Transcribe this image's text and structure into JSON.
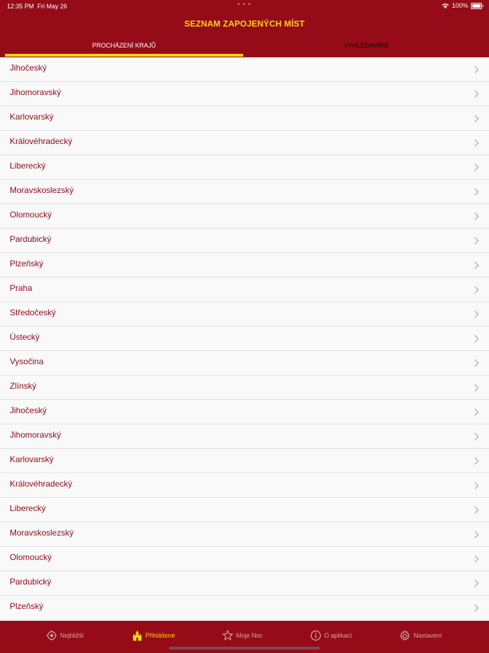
{
  "status_bar": {
    "time": "12:35 PM",
    "date": "Fri May 26",
    "dots": "• • •",
    "battery": "100%"
  },
  "nav": {
    "title": "SEZNAM ZAPOJENÝCH MÍST"
  },
  "tabs": [
    {
      "label": "PROCHÁZENÍ KRAJŮ",
      "active": true
    },
    {
      "label": "VYHLEDÁVÁNÍ",
      "active": false
    }
  ],
  "regions": [
    "Jihočeský",
    "Jihomoravský",
    "Karlovarský",
    "Královéhradecký",
    "Liberecký",
    "Moravskoslezský",
    "Olomoucký",
    "Pardubický",
    "Plzeňský",
    "Praha",
    "Středočeský",
    "Ústecký",
    "Vysočina",
    "Zlínský",
    "Jihočeský",
    "Jihomoravský",
    "Karlovarský",
    "Královéhradecký",
    "Liberecký",
    "Moravskoslezský",
    "Olomoucký",
    "Pardubický",
    "Plzeňský"
  ],
  "tabbar": [
    {
      "label": "Nejbližší",
      "icon": "location-target-icon",
      "active": false
    },
    {
      "label": "Přihlášené",
      "icon": "castle-icon",
      "active": true
    },
    {
      "label": "Moje Noc",
      "icon": "star-icon",
      "active": false
    },
    {
      "label": "O aplikaci",
      "icon": "info-icon",
      "active": false
    },
    {
      "label": "Nastavení",
      "icon": "gear-icon",
      "active": false
    }
  ],
  "colors": {
    "brand_red": "#950c18",
    "accent_yellow": "#fbd416",
    "row_text": "#8d0a18",
    "inactive_tab": "#cfa6aa"
  }
}
